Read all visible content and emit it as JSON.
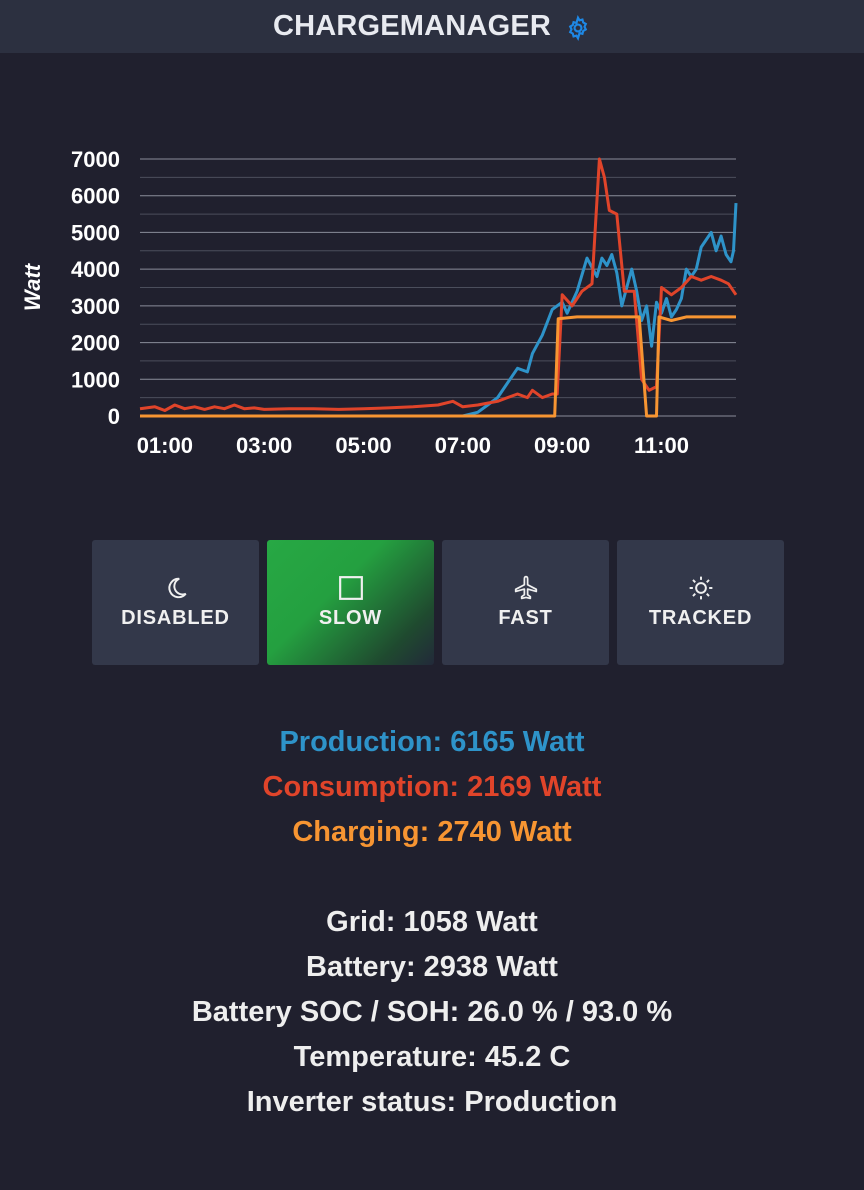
{
  "header": {
    "title": "CHARGEMANAGER",
    "settings_icon": "gear-icon",
    "accent": "#1e88e5"
  },
  "chart_data": {
    "type": "line",
    "ylabel": "Watt",
    "xlabel": "",
    "ylim": [
      0,
      7000
    ],
    "yticks": [
      "0",
      "1000",
      "2000",
      "3000",
      "4000",
      "5000",
      "6000",
      "7000"
    ],
    "xticks": [
      {
        "t": 1,
        "label": "01:00"
      },
      {
        "t": 3,
        "label": "03:00"
      },
      {
        "t": 5,
        "label": "05:00"
      },
      {
        "t": 7,
        "label": "07:00"
      },
      {
        "t": 9,
        "label": "09:00"
      },
      {
        "t": 11,
        "label": "11:00"
      }
    ],
    "xlim": [
      0.5,
      12.5
    ],
    "grid": true,
    "series": [
      {
        "name": "Production",
        "color": "#2e93c9",
        "points": [
          [
            0.5,
            0
          ],
          [
            7.0,
            0
          ],
          [
            7.3,
            100
          ],
          [
            7.5,
            300
          ],
          [
            7.7,
            500
          ],
          [
            7.9,
            900
          ],
          [
            8.1,
            1300
          ],
          [
            8.3,
            1200
          ],
          [
            8.4,
            1700
          ],
          [
            8.6,
            2200
          ],
          [
            8.8,
            2900
          ],
          [
            9.0,
            3100
          ],
          [
            9.1,
            2800
          ],
          [
            9.3,
            3400
          ],
          [
            9.5,
            4300
          ],
          [
            9.7,
            3800
          ],
          [
            9.8,
            4300
          ],
          [
            9.9,
            4100
          ],
          [
            10.0,
            4400
          ],
          [
            10.1,
            3900
          ],
          [
            10.2,
            3000
          ],
          [
            10.4,
            4000
          ],
          [
            10.5,
            3400
          ],
          [
            10.6,
            2600
          ],
          [
            10.7,
            3000
          ],
          [
            10.8,
            1900
          ],
          [
            10.9,
            3100
          ],
          [
            11.0,
            2800
          ],
          [
            11.1,
            3200
          ],
          [
            11.2,
            2700
          ],
          [
            11.3,
            2900
          ],
          [
            11.4,
            3200
          ],
          [
            11.5,
            4000
          ],
          [
            11.6,
            3800
          ],
          [
            11.7,
            4000
          ],
          [
            11.8,
            4600
          ],
          [
            12.0,
            5000
          ],
          [
            12.1,
            4500
          ],
          [
            12.2,
            4900
          ],
          [
            12.3,
            4400
          ],
          [
            12.4,
            4200
          ],
          [
            12.45,
            4500
          ],
          [
            12.5,
            5800
          ]
        ]
      },
      {
        "name": "Consumption",
        "color": "#e0442a",
        "points": [
          [
            0.5,
            200
          ],
          [
            0.8,
            250
          ],
          [
            1.0,
            150
          ],
          [
            1.2,
            300
          ],
          [
            1.4,
            200
          ],
          [
            1.6,
            250
          ],
          [
            1.8,
            180
          ],
          [
            2.0,
            250
          ],
          [
            2.2,
            200
          ],
          [
            2.4,
            300
          ],
          [
            2.6,
            200
          ],
          [
            2.8,
            220
          ],
          [
            3.0,
            180
          ],
          [
            3.5,
            200
          ],
          [
            4.0,
            200
          ],
          [
            4.5,
            180
          ],
          [
            5.0,
            200
          ],
          [
            5.5,
            220
          ],
          [
            6.0,
            250
          ],
          [
            6.5,
            300
          ],
          [
            6.8,
            400
          ],
          [
            7.0,
            250
          ],
          [
            7.3,
            300
          ],
          [
            7.5,
            350
          ],
          [
            7.7,
            400
          ],
          [
            7.9,
            500
          ],
          [
            8.1,
            600
          ],
          [
            8.3,
            500
          ],
          [
            8.4,
            700
          ],
          [
            8.6,
            500
          ],
          [
            8.8,
            600
          ],
          [
            8.9,
            600
          ],
          [
            9.0,
            3300
          ],
          [
            9.2,
            3000
          ],
          [
            9.4,
            3400
          ],
          [
            9.6,
            3600
          ],
          [
            9.75,
            7000
          ],
          [
            9.85,
            6500
          ],
          [
            9.95,
            5600
          ],
          [
            10.1,
            5500
          ],
          [
            10.25,
            3400
          ],
          [
            10.45,
            3400
          ],
          [
            10.6,
            1000
          ],
          [
            10.75,
            700
          ],
          [
            10.9,
            800
          ],
          [
            11.0,
            3500
          ],
          [
            11.2,
            3300
          ],
          [
            11.4,
            3500
          ],
          [
            11.6,
            3800
          ],
          [
            11.8,
            3700
          ],
          [
            12.0,
            3800
          ],
          [
            12.2,
            3700
          ],
          [
            12.35,
            3600
          ],
          [
            12.5,
            3300
          ]
        ]
      },
      {
        "name": "Charging",
        "color": "#f79532",
        "points": [
          [
            0.5,
            0
          ],
          [
            8.85,
            0
          ],
          [
            8.92,
            2650
          ],
          [
            9.3,
            2700
          ],
          [
            9.8,
            2700
          ],
          [
            10.2,
            2700
          ],
          [
            10.4,
            2700
          ],
          [
            10.55,
            2700
          ],
          [
            10.7,
            0
          ],
          [
            10.9,
            0
          ],
          [
            10.95,
            2700
          ],
          [
            11.2,
            2600
          ],
          [
            11.5,
            2700
          ],
          [
            12.0,
            2700
          ],
          [
            12.5,
            2700
          ]
        ]
      }
    ]
  },
  "modes": [
    {
      "label": "DISABLED",
      "icon": "moon-icon",
      "active": false
    },
    {
      "label": "SLOW",
      "icon": "square-icon",
      "active": true
    },
    {
      "label": "FAST",
      "icon": "airplane-icon",
      "active": false
    },
    {
      "label": "TRACKED",
      "icon": "sun-icon",
      "active": false
    }
  ],
  "stats": {
    "production": "Production: 6165 Watt",
    "consumption": "Consumption: 2169 Watt",
    "charging": "Charging: 2740 Watt",
    "grid": "Grid: 1058 Watt",
    "battery": "Battery: 2938 Watt",
    "soc_soh": "Battery SOC / SOH: 26.0 % / 93.0 %",
    "temperature": "Temperature: 45.2 C",
    "inverter": "Inverter status: Production"
  }
}
